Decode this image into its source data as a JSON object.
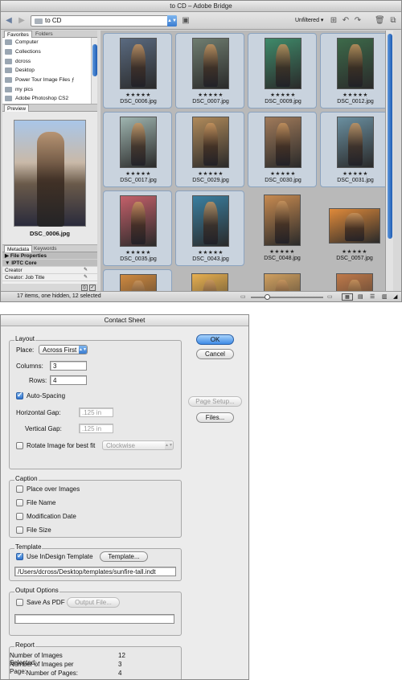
{
  "bridge": {
    "title": "to CD – Adobe Bridge",
    "path": "to CD",
    "filter_label": "Unfiltered",
    "panel_tabs": [
      "Favorites",
      "Folders"
    ],
    "favorites": [
      "Computer",
      "Collections",
      "dcross",
      "Desktop",
      "Power Tour Image Files ƒ",
      "my pics",
      "Adobe Photoshop CS2"
    ],
    "preview_tab": "Preview",
    "preview_name": "DSC_0006.jpg",
    "meta_tabs": [
      "Metadata",
      "Keywords"
    ],
    "meta_sections": [
      "File Properties",
      "IPTC Core"
    ],
    "meta_fields": [
      "Creator",
      "Creator: Job Title"
    ],
    "thumbnails": [
      {
        "name": "DSC_0006.jpg",
        "stars": "★★★★★",
        "selected": true,
        "color": "#5a6a80"
      },
      {
        "name": "DSC_0007.jpg",
        "stars": "★★★★★",
        "selected": true,
        "color": "#6f7d70"
      },
      {
        "name": "DSC_0009.jpg",
        "stars": "★★★★★",
        "selected": true,
        "color": "#3f8a6a"
      },
      {
        "name": "DSC_0012.jpg",
        "stars": "★★★★★",
        "selected": true,
        "color": "#3d6a4a"
      },
      {
        "name": "DSC_0017.jpg",
        "stars": "★★★★★",
        "selected": true,
        "color": "#9fb5b0"
      },
      {
        "name": "DSC_0029.jpg",
        "stars": "★★★★★",
        "selected": true,
        "color": "#b08a5a"
      },
      {
        "name": "DSC_0030.jpg",
        "stars": "★★★★★",
        "selected": true,
        "color": "#a07a5a"
      },
      {
        "name": "DSC_0031.jpg",
        "stars": "★★★★★",
        "selected": true,
        "color": "#6a8fa0"
      },
      {
        "name": "DSC_0035.jpg",
        "stars": "★★★★★",
        "selected": true,
        "color": "#c4606a"
      },
      {
        "name": "DSC_0043.jpg",
        "stars": "★★★★★",
        "selected": true,
        "color": "#3a7fa0"
      },
      {
        "name": "DSC_0048.jpg",
        "stars": "★★★★★",
        "selected": false,
        "color": "#c78a50"
      },
      {
        "name": "DSC_0057.jpg",
        "stars": "★★★★★",
        "selected": false,
        "color": "#e08a3a"
      },
      {
        "name": "",
        "stars": "",
        "selected": true,
        "color": "#d08a40"
      },
      {
        "name": "",
        "stars": "",
        "selected": false,
        "color": "#e8b050"
      },
      {
        "name": "",
        "stars": "",
        "selected": false,
        "color": "#d0a060"
      },
      {
        "name": "",
        "stars": "",
        "selected": false,
        "color": "#c07a4a"
      }
    ],
    "status": "17 items, one hidden, 12 selected",
    "thumb_size_level": 0.22,
    "accent": "#3a7cd0"
  },
  "dialog": {
    "title": "Contact Sheet",
    "ok": "OK",
    "cancel": "Cancel",
    "page_setup": "Page Setup...",
    "files": "Files...",
    "layout": {
      "label": "Layout",
      "place_label": "Place:",
      "place_value": "Across First",
      "columns_label": "Columns:",
      "columns_value": "3",
      "rows_label": "Rows:",
      "rows_value": "4",
      "auto_spacing": "Auto-Spacing",
      "hgap_label": "Horizontal Gap:",
      "hgap_value": ".125 in",
      "vgap_label": "Vertical Gap:",
      "vgap_value": ".125 in",
      "rotate_label": "Rotate Image for best fit",
      "rotate_value": "Clockwise"
    },
    "caption": {
      "label": "Caption",
      "options": [
        "Place over Images",
        "File Name",
        "Modification Date",
        "File Size"
      ]
    },
    "template": {
      "label": "Template",
      "use_label": "Use InDesign Template",
      "button": "Template...",
      "path": "/Users/dcross/Desktop/templates/sunfire-tall.indt"
    },
    "output": {
      "label": "Output Options",
      "save_pdf": "Save As PDF",
      "output_file": "Output File..."
    },
    "report": {
      "label": "Report",
      "rows": [
        {
          "label": "Number of Images Selected:",
          "value": "12"
        },
        {
          "label": "Number of Images per Page:",
          "value": "3"
        },
        {
          "label": "Number of Pages:",
          "value": "4"
        }
      ]
    }
  }
}
